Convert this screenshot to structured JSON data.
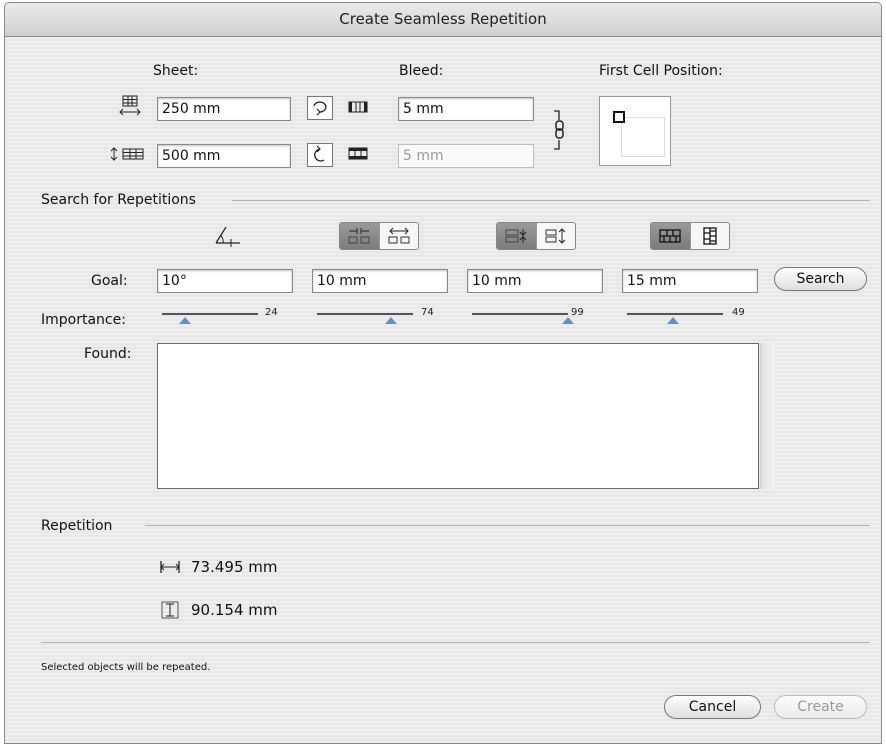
{
  "window": {
    "title": "Create Seamless Repetition"
  },
  "sheet": {
    "label": "Sheet:",
    "width": "250 mm",
    "height": "500 mm"
  },
  "bleed": {
    "label": "Bleed:",
    "horizontal": "5 mm",
    "vertical": "5 mm"
  },
  "first_cell": {
    "label": "First Cell Position:"
  },
  "search": {
    "section_title": "Search for Repetitions",
    "goal_label": "Goal:",
    "goal_values": [
      "10°",
      "10 mm",
      "10 mm",
      "15 mm"
    ],
    "search_button": "Search",
    "importance_label": "Importance:",
    "importance_values": [
      "24",
      "74",
      "99",
      "49"
    ],
    "found_label": "Found:"
  },
  "repetition": {
    "section_title": "Repetition",
    "width": "73.495 mm",
    "height": "90.154 mm"
  },
  "footer": {
    "note": "Selected objects will be repeated.",
    "cancel_button": "Cancel",
    "create_button": "Create"
  },
  "colors": {
    "slider_thumb": "#6b8fc4",
    "segment_on": "#7c7c7c"
  }
}
